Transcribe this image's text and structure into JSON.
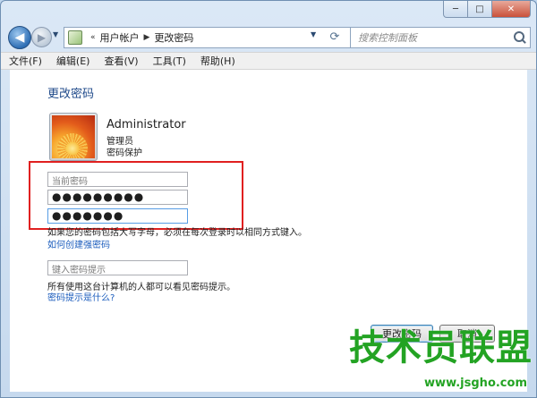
{
  "window": {
    "minimize": "─",
    "maximize": "□",
    "close": "✕"
  },
  "navigation": {
    "back": "◀",
    "forward": "▶",
    "breadcrumb": [
      "用户帐户",
      "更改密码"
    ],
    "search_placeholder": "搜索控制面板"
  },
  "menu": [
    "文件(F)",
    "编辑(E)",
    "查看(V)",
    "工具(T)",
    "帮助(H)"
  ],
  "page": {
    "title": "更改密码",
    "user": {
      "name": "Administrator",
      "role": "管理员",
      "protection": "密码保护"
    },
    "fields": {
      "current_password_placeholder": "当前密码",
      "new_password_value": "●●●●●●●●●",
      "confirm_password_value": "●●●●●●●",
      "hint_placeholder": "键入密码提示"
    },
    "case_note": "如果您的密码包括大写字母，必须在每次登录时以相同方式键入。",
    "strong_password_link": "如何创建强密码",
    "hint_note": "所有使用这台计算机的人都可以看见密码提示。",
    "hint_link": "密码提示是什么?",
    "buttons": {
      "change": "更改密码",
      "cancel": "取消"
    }
  },
  "watermark": {
    "brand": "技术员联盟",
    "url": "www.jsgho.com"
  },
  "colors": {
    "link": "#1c5dbd",
    "heading": "#1f4a8a",
    "highlight_box": "#e02020",
    "watermark": "#23a323"
  }
}
